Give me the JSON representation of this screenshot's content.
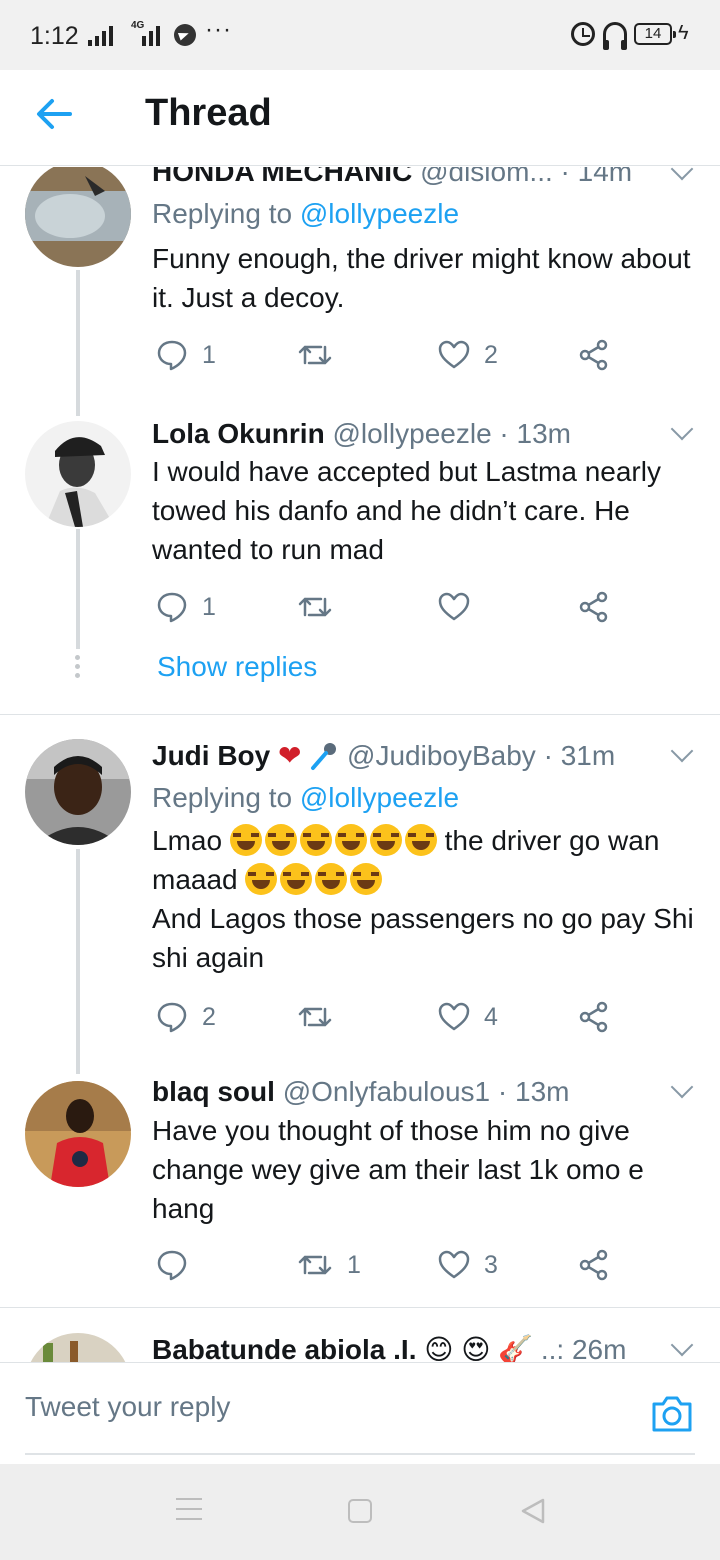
{
  "status_bar": {
    "time": "1:12",
    "network": "4G",
    "more": "···",
    "battery": "14"
  },
  "header": {
    "title": "Thread"
  },
  "tweets": [
    {
      "name": "HONDA MECHANIC",
      "handle": "@disiom...",
      "time": "· 14m",
      "reply_prefix": "Replying to ",
      "reply_handle": "@lollypeezle",
      "text": "Funny enough, the driver might know about it. Just a decoy.",
      "replies": "1",
      "retweets": "",
      "likes": "2"
    },
    {
      "name": "Lola Okunrin",
      "handle": "@lollypeezle",
      "time": "· 13m",
      "text": "I would have accepted but Lastma nearly towed his danfo and he didn’t care. He wanted to run mad",
      "replies": "1",
      "retweets": "",
      "likes": ""
    },
    {
      "name": "Judi Boy",
      "handle": "@JudiboyBaby",
      "time": "· 31m",
      "reply_prefix": "Replying to ",
      "reply_handle": "@lollypeezle",
      "text_a": "Lmao",
      "text_b": "the driver go wan",
      "text_c": "maaad",
      "text_d": "And Lagos those passengers no go pay Shi shi again",
      "replies": "2",
      "retweets": "",
      "likes": "4"
    },
    {
      "name": "blaq soul",
      "handle": "@Onlyfabulous1",
      "time": "· 13m",
      "text": "Have you thought of those him no give change wey give am their last 1k omo e hang",
      "replies": "",
      "retweets": "1",
      "likes": "3"
    },
    {
      "name": "Babatunde abiola .I.",
      "handle": "..:",
      "time": "26m"
    }
  ],
  "show_replies": "Show replies",
  "compose": {
    "placeholder": "Tweet your reply"
  },
  "icons": {
    "back": "arrow-left-icon",
    "reply": "speech-bubble-icon",
    "retweet": "retweet-icon",
    "like": "heart-icon",
    "share": "share-icon",
    "camera": "camera-icon"
  },
  "colors": {
    "accent": "#1da1f2",
    "text": "#14171a",
    "secondary": "#657786"
  }
}
